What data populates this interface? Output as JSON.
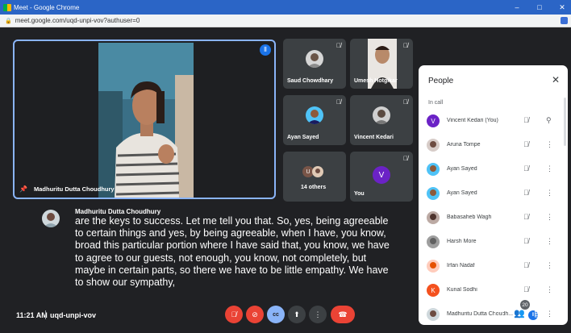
{
  "browser": {
    "tab_title": "Meet - Google Chrome",
    "url": "meet.google.com/uqd-unpi-vov?authuser=0",
    "minimize": "–",
    "maximize": "□",
    "close": "✕"
  },
  "main_speaker": {
    "name": "Madhuritu Dutta Choudhury"
  },
  "tiles": [
    {
      "name": "Saud Chowdhary"
    },
    {
      "name": "Umesh Hotgikar"
    },
    {
      "name": "Ayan Sayed"
    },
    {
      "name": "Vincent Kedari"
    },
    {
      "name": "14 others",
      "initials": "U"
    },
    {
      "name": "You",
      "initial": "V"
    }
  ],
  "captions": {
    "speaker": "Madhuritu Dutta Choudhury",
    "text": "are the keys to success. Let me tell you that. So, yes, being agreeable to certain things and yes, by being agreeable, when I have, you know, broad this particular portion where I have said that, you know, we have to agree to our guests, not enough, you know, not completely, but maybe in certain parts, so there we have to be little empathy. We have to show our sympathy,"
  },
  "bottom_bar": {
    "time": "11:21 AM",
    "meeting_code": "uqd-unpi-vov",
    "people_count": "20"
  },
  "people_panel": {
    "title": "People",
    "section": "In call",
    "participants": [
      {
        "name": "Vincent Kedari (You)",
        "initial": "V",
        "color": "#6b22c6"
      },
      {
        "name": "Aruna Tompe"
      },
      {
        "name": "Ayan Sayed"
      },
      {
        "name": "Ayan Sayed"
      },
      {
        "name": "Babasaheb Wagh"
      },
      {
        "name": "Harsh More"
      },
      {
        "name": "Irfan Nadaf"
      },
      {
        "name": "Kunal Sodhi",
        "initial": "K",
        "color": "#f4511e"
      },
      {
        "name": "Madhuritu Dutta Choudh..."
      }
    ]
  },
  "colors": {
    "accent": "#8ab4f8",
    "background": "#202124",
    "tile": "#3c4043",
    "end_call": "#ea4335"
  }
}
